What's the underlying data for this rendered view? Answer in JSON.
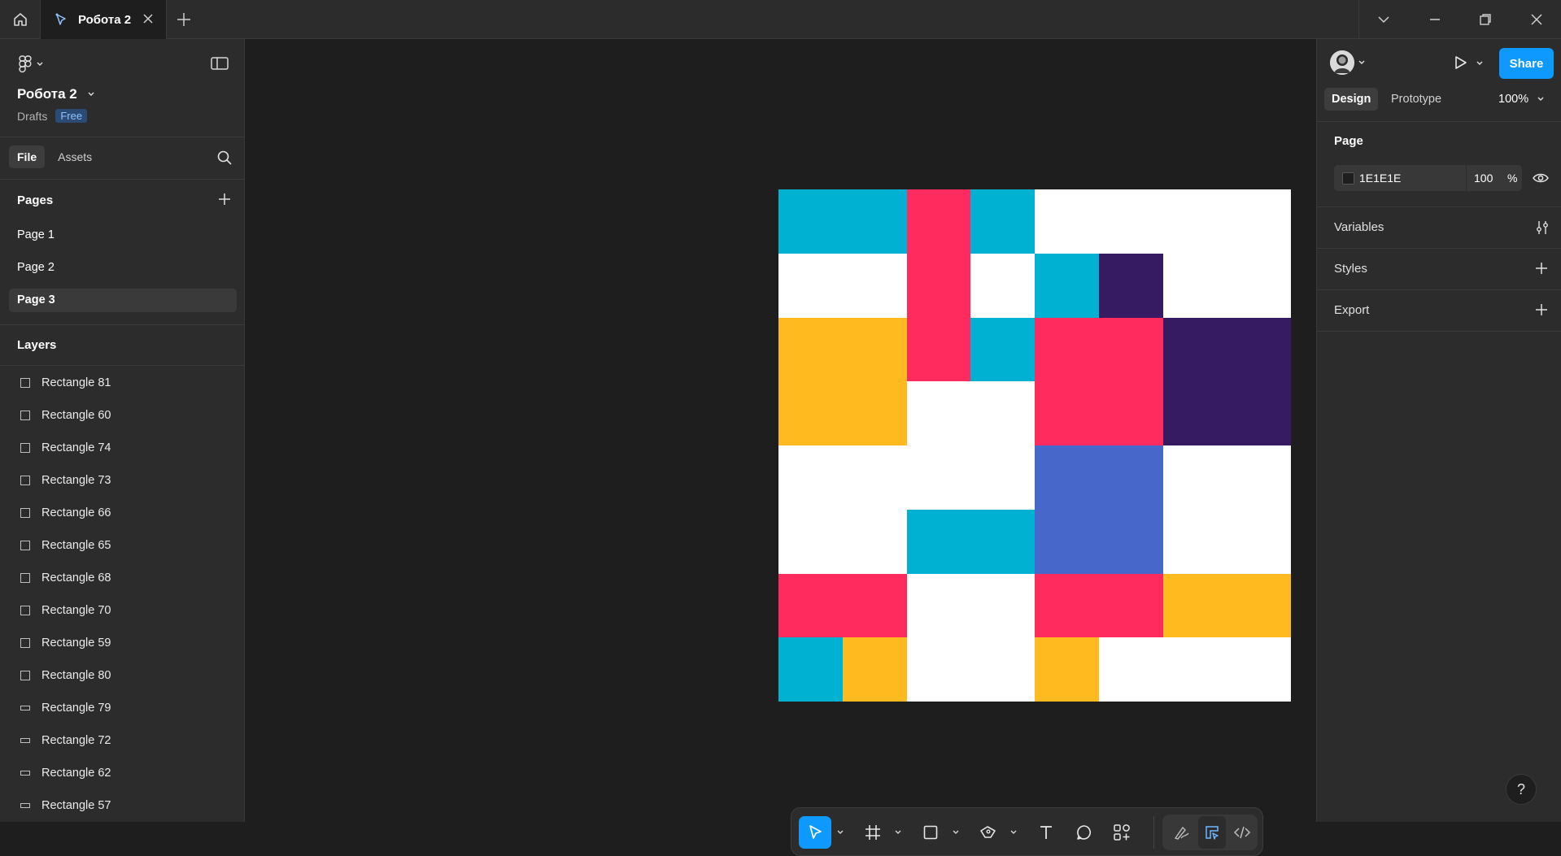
{
  "titlebar": {
    "tab_title": "Робота 2"
  },
  "file": {
    "title": "Робота 2",
    "location": "Drafts",
    "plan_badge": "Free"
  },
  "left_tabs": {
    "file": "File",
    "assets": "Assets"
  },
  "pages": {
    "heading": "Pages",
    "items": [
      {
        "label": "Page 1",
        "selected": false
      },
      {
        "label": "Page 2",
        "selected": false
      },
      {
        "label": "Page 3",
        "selected": true
      }
    ]
  },
  "layers": {
    "heading": "Layers",
    "items": [
      {
        "label": "Rectangle 81",
        "icon": "rectangle-icon"
      },
      {
        "label": "Rectangle 60",
        "icon": "rectangle-icon"
      },
      {
        "label": "Rectangle 74",
        "icon": "rectangle-icon"
      },
      {
        "label": "Rectangle 73",
        "icon": "rectangle-icon"
      },
      {
        "label": "Rectangle 66",
        "icon": "rectangle-icon"
      },
      {
        "label": "Rectangle 65",
        "icon": "rectangle-icon"
      },
      {
        "label": "Rectangle 68",
        "icon": "rectangle-icon"
      },
      {
        "label": "Rectangle 70",
        "icon": "rectangle-icon"
      },
      {
        "label": "Rectangle 59",
        "icon": "rectangle-icon"
      },
      {
        "label": "Rectangle 80",
        "icon": "rectangle-icon"
      },
      {
        "label": "Rectangle 79",
        "icon": "wide-rectangle-icon"
      },
      {
        "label": "Rectangle 72",
        "icon": "wide-rectangle-icon"
      },
      {
        "label": "Rectangle 62",
        "icon": "wide-rectangle-icon"
      },
      {
        "label": "Rectangle 57",
        "icon": "wide-rectangle-icon"
      }
    ]
  },
  "right_panel": {
    "share_label": "Share",
    "design_tab": "Design",
    "prototype_tab": "Prototype",
    "zoom": "100%",
    "page_heading": "Page",
    "page_fill_hex": "1E1E1E",
    "page_fill_opacity": "100",
    "page_fill_percent": "%",
    "variables_heading": "Variables",
    "styles_heading": "Styles",
    "export_heading": "Export",
    "help_label": "?"
  },
  "colors": {
    "canvas_bg": "#1e1e1e",
    "panel_bg": "#2c2c2c",
    "accent": "#0d99ff",
    "cyan": "#00b1d2",
    "pink": "#ff2a5d",
    "yellow": "#ffba1f",
    "purple": "#361b63",
    "blue": "#4767cb",
    "white": "#ffffff"
  },
  "artwork": {
    "grid_size": 8,
    "background": "#ffffff",
    "tiles": [
      {
        "col": 0,
        "row": 0,
        "w": 2,
        "h": 1,
        "color": "#00b1d2"
      },
      {
        "col": 2,
        "row": 0,
        "w": 1,
        "h": 3,
        "color": "#ff2a5d"
      },
      {
        "col": 3,
        "row": 0,
        "w": 1,
        "h": 1,
        "color": "#00b1d2"
      },
      {
        "col": 4,
        "row": 1,
        "w": 1,
        "h": 1,
        "color": "#00b1d2"
      },
      {
        "col": 5,
        "row": 1,
        "w": 1,
        "h": 1,
        "color": "#361b63"
      },
      {
        "col": 0,
        "row": 2,
        "w": 2,
        "h": 2,
        "color": "#ffba1f"
      },
      {
        "col": 3,
        "row": 2,
        "w": 1,
        "h": 1,
        "color": "#00b1d2"
      },
      {
        "col": 4,
        "row": 2,
        "w": 2,
        "h": 2,
        "color": "#ff2a5d"
      },
      {
        "col": 6,
        "row": 2,
        "w": 2,
        "h": 2,
        "color": "#361b63"
      },
      {
        "col": 4,
        "row": 4,
        "w": 2,
        "h": 2,
        "color": "#4767cb"
      },
      {
        "col": 2,
        "row": 5,
        "w": 2,
        "h": 1,
        "color": "#00b1d2"
      },
      {
        "col": 0,
        "row": 6,
        "w": 2,
        "h": 1,
        "color": "#ff2a5d"
      },
      {
        "col": 4,
        "row": 6,
        "w": 2,
        "h": 1,
        "color": "#ff2a5d"
      },
      {
        "col": 6,
        "row": 6,
        "w": 2,
        "h": 1,
        "color": "#ffba1f"
      },
      {
        "col": 0,
        "row": 7,
        "w": 1,
        "h": 1,
        "color": "#00b1d2"
      },
      {
        "col": 1,
        "row": 7,
        "w": 1,
        "h": 1,
        "color": "#ffba1f"
      },
      {
        "col": 4,
        "row": 7,
        "w": 1,
        "h": 1,
        "color": "#ffba1f"
      }
    ]
  },
  "toolbar": {
    "tools": [
      "move-tool",
      "frame-tool",
      "shape-tool",
      "pen-tool",
      "text-tool",
      "comment-tool",
      "actions-tool",
      "draw-mode",
      "design-mode",
      "dev-mode"
    ],
    "active_tool": "move-tool"
  }
}
